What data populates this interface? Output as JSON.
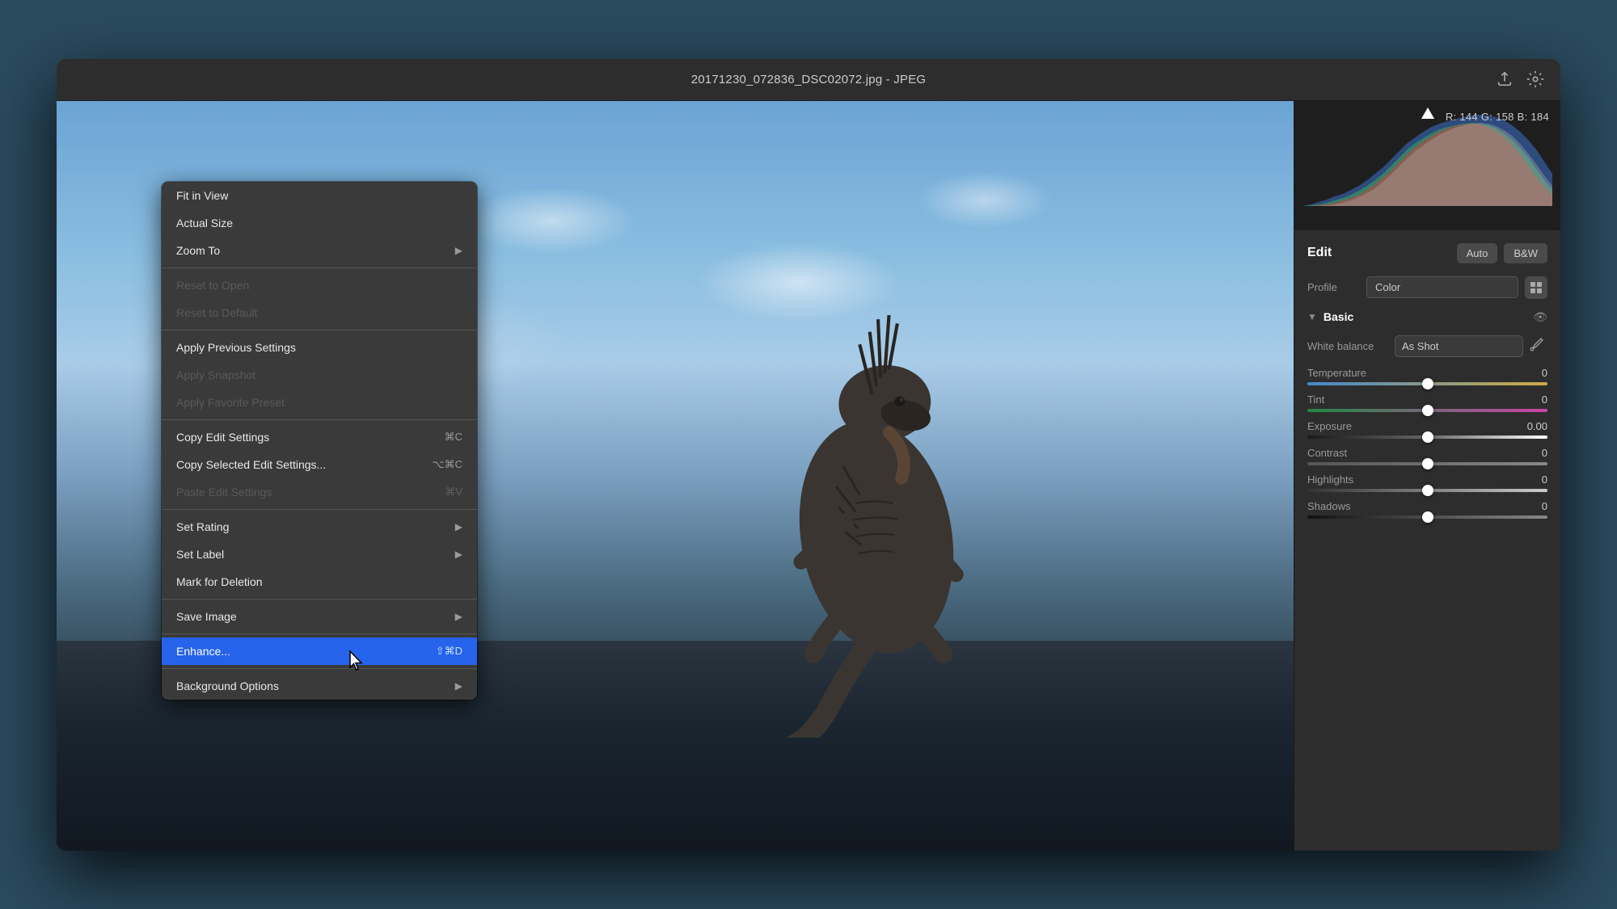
{
  "window": {
    "title": "20171230_072836_DSC02072.jpg  -  JPEG"
  },
  "histogram": {
    "rgb_label": "R: 144   G: 158   B: 184"
  },
  "edit_panel": {
    "title": "Edit",
    "auto_label": "Auto",
    "bw_label": "B&W",
    "profile_label": "Profile",
    "profile_value": "Color",
    "basic_section": "Basic",
    "white_balance_label": "White balance",
    "white_balance_value": "As Shot",
    "temperature_label": "Temperature",
    "temperature_value": "0",
    "tint_label": "Tint",
    "tint_value": "0",
    "exposure_label": "Exposure",
    "exposure_value": "0.00",
    "contrast_label": "Contrast",
    "contrast_value": "0",
    "highlights_label": "Highlights",
    "highlights_value": "0",
    "shadows_label": "Shadows",
    "shadows_value": "0"
  },
  "context_menu": {
    "items": [
      {
        "id": "fit-view",
        "label": "Fit in View",
        "shortcut": "",
        "arrow": false,
        "disabled": false,
        "highlighted": false
      },
      {
        "id": "actual-size",
        "label": "Actual Size",
        "shortcut": "",
        "arrow": false,
        "disabled": false,
        "highlighted": false
      },
      {
        "id": "zoom-to",
        "label": "Zoom To",
        "shortcut": "",
        "arrow": true,
        "disabled": false,
        "highlighted": false
      },
      {
        "id": "sep1",
        "type": "separator"
      },
      {
        "id": "reset-open",
        "label": "Reset to Open",
        "shortcut": "",
        "arrow": false,
        "disabled": true,
        "highlighted": false
      },
      {
        "id": "reset-default",
        "label": "Reset to Default",
        "shortcut": "",
        "arrow": false,
        "disabled": true,
        "highlighted": false
      },
      {
        "id": "sep2",
        "type": "separator"
      },
      {
        "id": "apply-prev",
        "label": "Apply Previous Settings",
        "shortcut": "",
        "arrow": false,
        "disabled": false,
        "highlighted": false
      },
      {
        "id": "apply-snapshot",
        "label": "Apply Snapshot",
        "shortcut": "",
        "arrow": false,
        "disabled": true,
        "highlighted": false
      },
      {
        "id": "apply-favorite",
        "label": "Apply Favorite Preset",
        "shortcut": "",
        "arrow": false,
        "disabled": true,
        "highlighted": false
      },
      {
        "id": "sep3",
        "type": "separator"
      },
      {
        "id": "copy-edit",
        "label": "Copy Edit Settings",
        "shortcut": "⌘C",
        "arrow": false,
        "disabled": false,
        "highlighted": false
      },
      {
        "id": "copy-selected",
        "label": "Copy Selected Edit Settings...",
        "shortcut": "⌥⌘C",
        "arrow": false,
        "disabled": false,
        "highlighted": false
      },
      {
        "id": "paste-edit",
        "label": "Paste Edit Settings",
        "shortcut": "⌘V",
        "arrow": false,
        "disabled": true,
        "highlighted": false
      },
      {
        "id": "sep4",
        "type": "separator"
      },
      {
        "id": "set-rating",
        "label": "Set Rating",
        "shortcut": "",
        "arrow": true,
        "disabled": false,
        "highlighted": false
      },
      {
        "id": "set-label",
        "label": "Set Label",
        "shortcut": "",
        "arrow": true,
        "disabled": false,
        "highlighted": false
      },
      {
        "id": "mark-delete",
        "label": "Mark for Deletion",
        "shortcut": "",
        "arrow": false,
        "disabled": false,
        "highlighted": false
      },
      {
        "id": "sep5",
        "type": "separator"
      },
      {
        "id": "save-image",
        "label": "Save Image",
        "shortcut": "",
        "arrow": true,
        "disabled": false,
        "highlighted": false
      },
      {
        "id": "sep6",
        "type": "separator"
      },
      {
        "id": "enhance",
        "label": "Enhance...",
        "shortcut": "⇧⌘D",
        "arrow": false,
        "disabled": false,
        "highlighted": true
      },
      {
        "id": "sep7",
        "type": "separator"
      },
      {
        "id": "background-options",
        "label": "Background Options",
        "shortcut": "",
        "arrow": true,
        "disabled": false,
        "highlighted": false
      }
    ]
  }
}
